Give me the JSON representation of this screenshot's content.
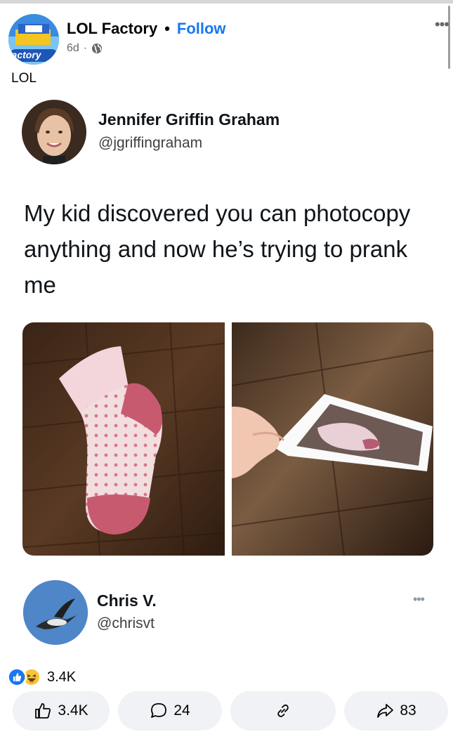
{
  "post": {
    "page_name": "LOL Factory",
    "follow_label": "Follow",
    "separator": "•",
    "age": "6d",
    "meta_sep": "·",
    "caption": "LOL",
    "avatar_text": "Factory",
    "more_icon": "more-horizontal-icon"
  },
  "tweet": {
    "author_name": "Jennifer Griffin Graham",
    "author_handle": "@jgriffingraham",
    "text": "My kid discovered you can photocopy anything and now he’s trying to prank me"
  },
  "reply": {
    "author_name": "Chris V.",
    "author_handle": "@chrisvt"
  },
  "reactions": {
    "count": "3.4K",
    "icons": [
      "like-icon",
      "haha-icon"
    ]
  },
  "actions": {
    "like_count": "3.4K",
    "comment_count": "24",
    "share_count": "83"
  },
  "colors": {
    "accent": "#1877f2",
    "secondary_text": "#65676b",
    "button_bg": "#f0f2f5"
  }
}
